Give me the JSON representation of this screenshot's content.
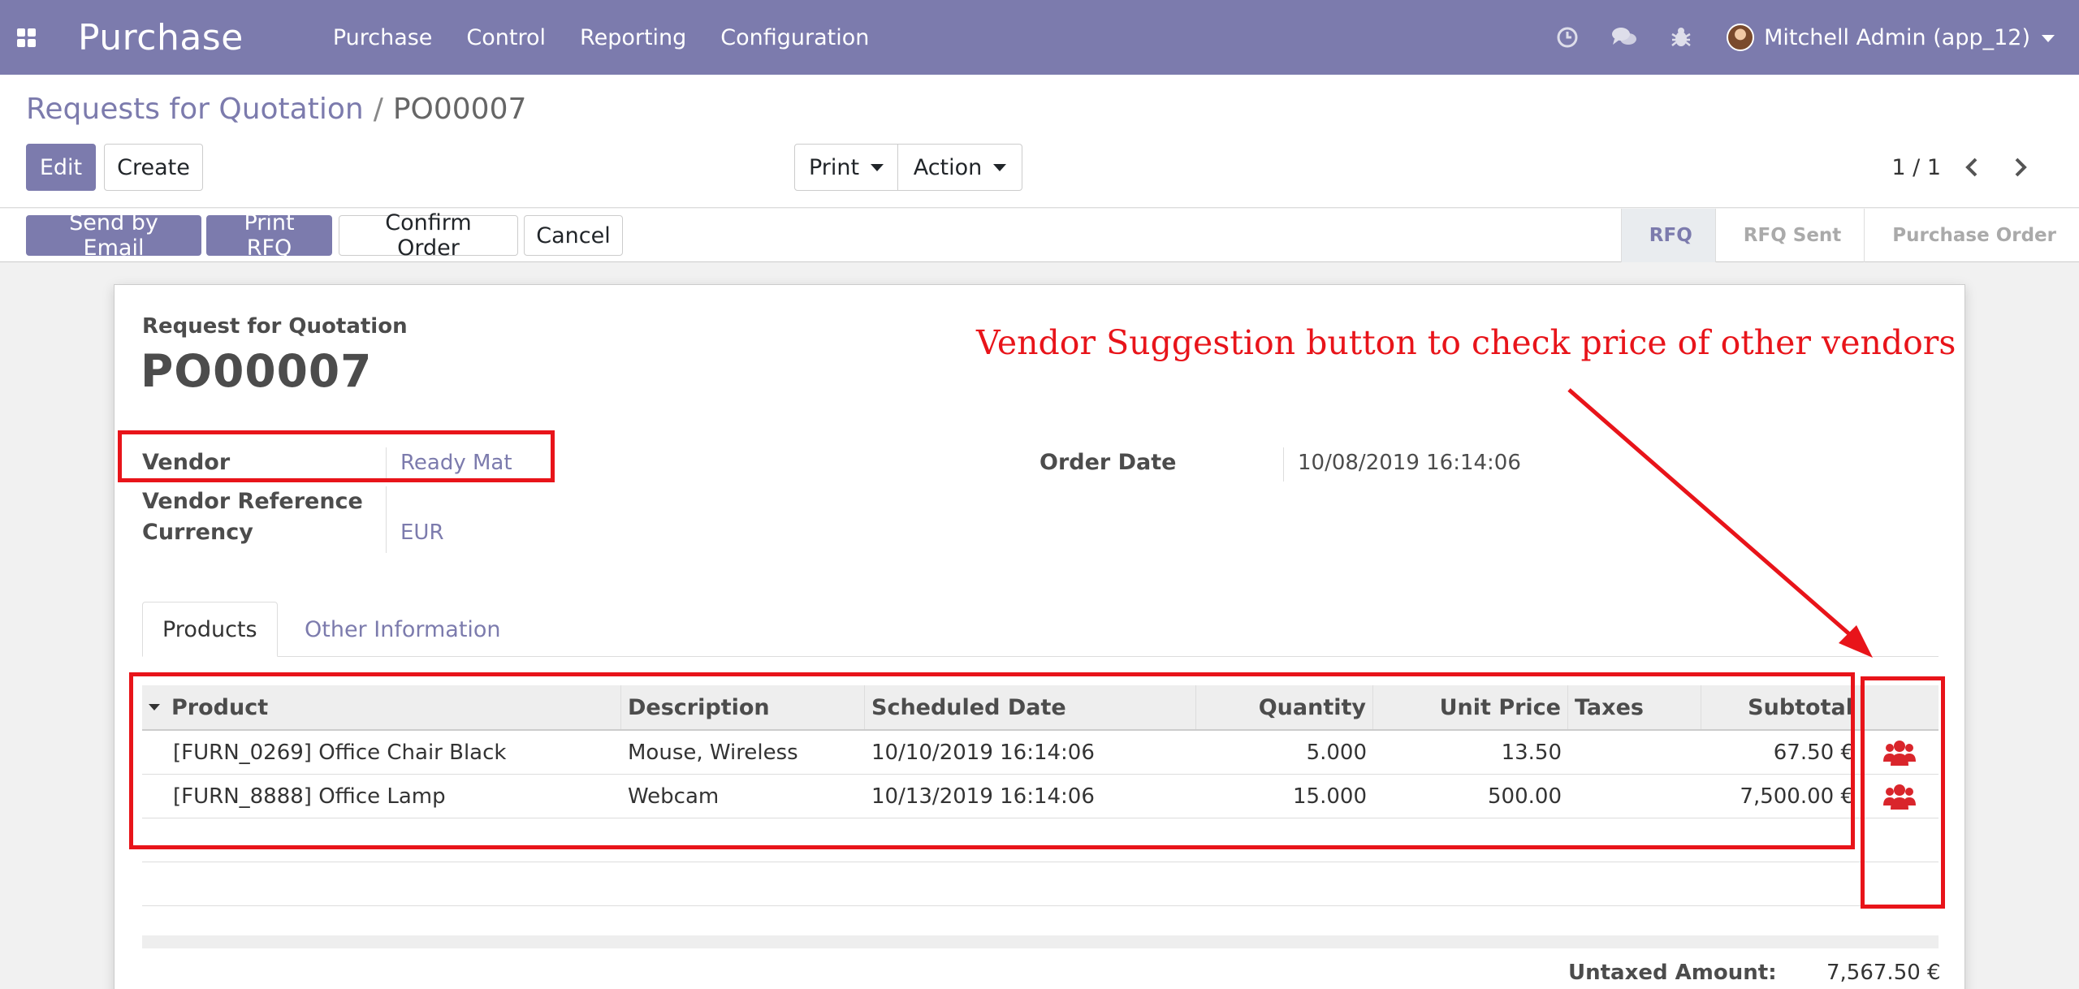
{
  "navbar": {
    "app_name": "Purchase",
    "menu": [
      "Purchase",
      "Control",
      "Reporting",
      "Configuration"
    ],
    "icons": [
      "clock-icon",
      "chat-icon",
      "bug-icon"
    ],
    "user": "Mitchell Admin (app_12)"
  },
  "breadcrumb": {
    "parent": "Requests for Quotation",
    "separator": "/",
    "current": "PO00007"
  },
  "buttons": {
    "edit": "Edit",
    "create": "Create",
    "print": "Print",
    "action": "Action"
  },
  "pager": {
    "value": "1 / 1"
  },
  "statusbar": {
    "send_email": "Send by Email",
    "print_rfq": "Print RFQ",
    "confirm": "Confirm Order",
    "cancel": "Cancel",
    "stages": [
      {
        "label": "RFQ",
        "active": true
      },
      {
        "label": "RFQ Sent",
        "active": false
      },
      {
        "label": "Purchase Order",
        "active": false
      }
    ]
  },
  "form": {
    "doc_type": "Request for Quotation",
    "doc_number": "PO00007",
    "fields": {
      "vendor_label": "Vendor",
      "vendor_value": "Ready Mat",
      "vendor_ref_label": "Vendor Reference",
      "currency_label": "Currency",
      "currency_value": "EUR",
      "order_date_label": "Order Date",
      "order_date_value": "10/08/2019 16:14:06"
    },
    "tabs": [
      "Products",
      "Other Information"
    ],
    "table": {
      "headers": {
        "product": "Product",
        "description": "Description",
        "scheduled_date": "Scheduled Date",
        "quantity": "Quantity",
        "unit_price": "Unit Price",
        "taxes": "Taxes",
        "subtotal": "Subtotal"
      },
      "rows": [
        {
          "product": "[FURN_0269] Office Chair Black",
          "description": "Mouse, Wireless",
          "scheduled_date": "10/10/2019 16:14:06",
          "quantity": "5.000",
          "unit_price": "13.50",
          "taxes": "",
          "subtotal": "67.50 €"
        },
        {
          "product": "[FURN_8888] Office Lamp",
          "description": "Webcam",
          "scheduled_date": "10/13/2019 16:14:06",
          "quantity": "15.000",
          "unit_price": "500.00",
          "taxes": "",
          "subtotal": "7,500.00 €"
        }
      ]
    },
    "totals": {
      "untaxed_label": "Untaxed Amount:",
      "untaxed_value": "7,567.50 €"
    }
  },
  "annotation": {
    "text": "Vendor Suggestion button to check price of other vendors",
    "color": "#e8141a"
  },
  "colors": {
    "brand": "#7c7bad",
    "vendor_icon": "#d9252b"
  }
}
